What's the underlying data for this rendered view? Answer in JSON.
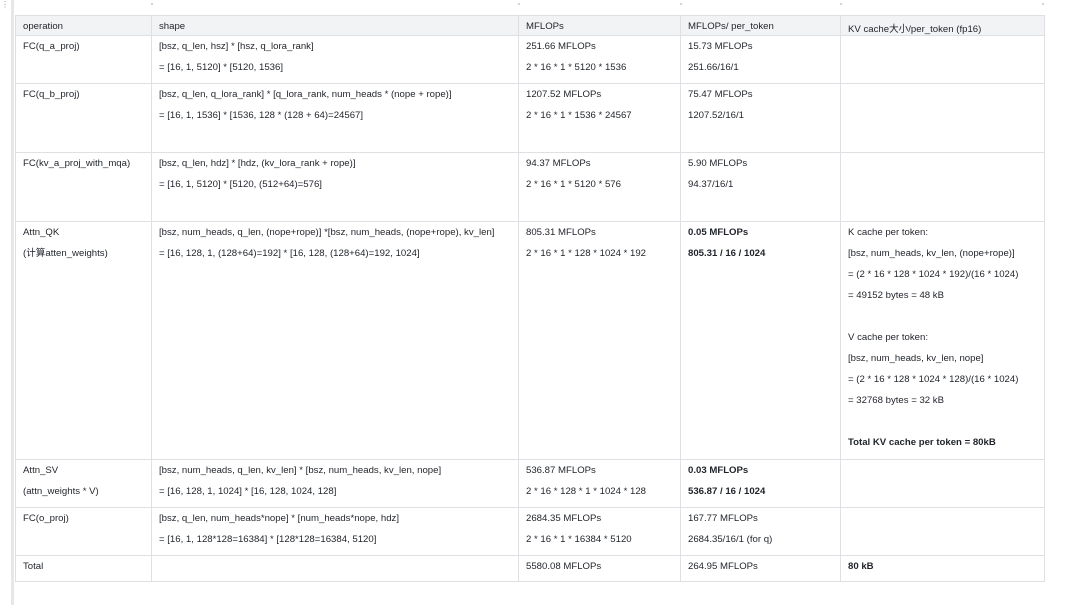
{
  "edge": {
    "dots": "⋮"
  },
  "columns": [
    "operation",
    "shape",
    "MFLOPs",
    "MFLOPs/ per_token",
    "KV cache大小/per_token (fp16)"
  ],
  "rows": [
    {
      "operation": [
        "FC(q_a_proj)"
      ],
      "shape": [
        "[bsz, q_len, hsz] * [hsz, q_lora_rank]",
        "= [16, 1, 5120] * [5120, 1536]"
      ],
      "mflops": [
        "251.66 MFLOPs",
        "2 * 16 * 1 * 5120 * 1536"
      ],
      "per_token": [
        {
          "t": "15.73 MFLOPs"
        },
        {
          "t": "251.66/16/1"
        }
      ],
      "kv": []
    },
    {
      "operation": [
        "FC(q_b_proj)"
      ],
      "shape": [
        "[bsz, q_len, q_lora_rank] * [q_lora_rank, num_heads * (nope + rope)]",
        "= [16, 1, 1536] * [1536, 128 * (128 + 64)=24567]"
      ],
      "mflops": [
        "1207.52 MFLOPs",
        "2 * 16 * 1 * 1536 * 24567"
      ],
      "per_token": [
        {
          "t": "75.47 MFLOPs"
        },
        {
          "t": "1207.52/16/1"
        }
      ],
      "kv": []
    },
    {
      "operation": [
        "FC(kv_a_proj_with_mqa)"
      ],
      "shape": [
        "[bsz, q_len, hdz] * [hdz, (kv_lora_rank + rope)]",
        "= [16, 1, 5120] * [5120, (512+64)=576]"
      ],
      "mflops": [
        "94.37 MFLOPs",
        "2 * 16 * 1 * 5120 * 576"
      ],
      "per_token": [
        {
          "t": "5.90 MFLOPs"
        },
        {
          "t": "94.37/16/1"
        }
      ],
      "kv": []
    },
    {
      "operation": [
        "Attn_QK",
        "(计算atten_weights)"
      ],
      "shape": [
        "[bsz, num_heads, q_len, (nope+rope)] *[bsz, num_heads, (nope+rope), kv_len]",
        "= [16, 128, 1, (128+64)=192] * [16, 128, (128+64)=192, 1024]"
      ],
      "mflops": [
        "805.31 MFLOPs",
        "2 * 16 * 1 * 128 * 1024 * 192"
      ],
      "per_token": [
        {
          "t": "0.05 MFLOPs",
          "b": true
        },
        {
          "t": "805.31 / 16 / 1024",
          "b": true
        }
      ],
      "kv": [
        {
          "t": "K cache per token:"
        },
        {
          "t": "[bsz, num_heads, kv_len, (nope+rope)]"
        },
        {
          "t": "= (2 * 16 * 128 * 1024 * 192)/(16 * 1024)"
        },
        {
          "t": "= 49152 bytes = 48 kB"
        },
        {
          "t": ""
        },
        {
          "t": "V cache per token:"
        },
        {
          "t": "[bsz, num_heads, kv_len, nope]"
        },
        {
          "t": "= (2 * 16 * 128 * 1024 * 128)/(16 * 1024)"
        },
        {
          "t": "= 32768 bytes = 32 kB"
        },
        {
          "t": ""
        },
        {
          "t": "Total KV cache per token = 80kB",
          "b": true
        }
      ]
    },
    {
      "operation": [
        "Attn_SV",
        "(attn_weights * V)"
      ],
      "shape": [
        "[bsz, num_heads, q_len, kv_len] * [bsz, num_heads, kv_len, nope]",
        "= [16, 128, 1, 1024] * [16, 128, 1024, 128]"
      ],
      "mflops": [
        "536.87 MFLOPs",
        "2 * 16 * 128 * 1 * 1024 * 128"
      ],
      "per_token": [
        {
          "t": "0.03 MFLOPs",
          "b": true
        },
        {
          "t": "536.87 / 16 / 1024",
          "b": true
        }
      ],
      "kv": []
    },
    {
      "operation": [
        "FC(o_proj)"
      ],
      "shape": [
        "[bsz, q_len, num_heads*nope] * [num_heads*nope, hdz]",
        "= [16, 1, 128*128=16384] * [128*128=16384, 5120]"
      ],
      "mflops": [
        "2684.35 MFLOPs",
        "2 * 16 * 1 * 16384 * 5120"
      ],
      "per_token": [
        {
          "t": "167.77 MFLOPs"
        },
        {
          "t": "2684.35/16/1 (for q)"
        }
      ],
      "kv": []
    },
    {
      "operation": [
        "Total"
      ],
      "shape": [],
      "mflops": [
        "5580.08 MFLOPs"
      ],
      "per_token": [
        {
          "t": "264.95 MFLOPs"
        }
      ],
      "kv": [
        {
          "t": "80 kB",
          "b": true
        }
      ]
    }
  ]
}
